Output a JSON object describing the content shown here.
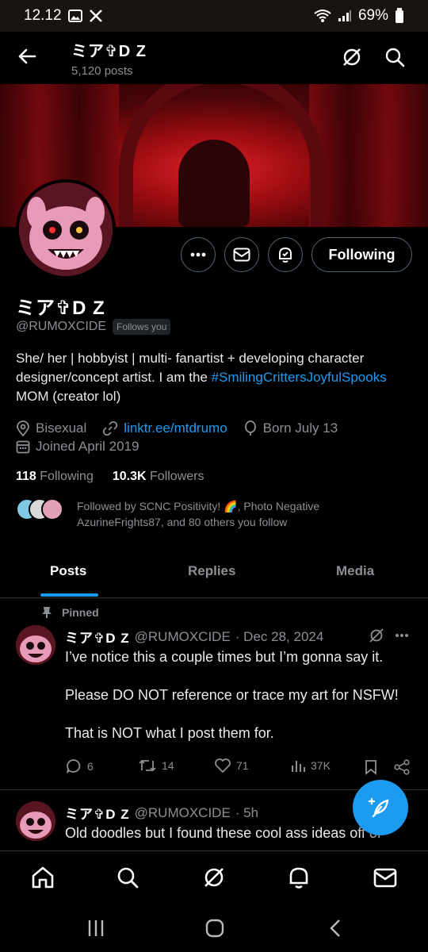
{
  "status_bar": {
    "time": "12.12",
    "battery": "69%"
  },
  "header": {
    "title": "ミア✞D Z",
    "post_count": "5,120 posts"
  },
  "profile": {
    "name": "ミア✞D Z",
    "handle": "@RUMOXCIDE",
    "follows_you": "Follows you",
    "follow_button": "Following",
    "bio_part1": "She/ her | hobbyist | multi- fanartist + developing character designer/concept artist. I am the ",
    "bio_hashtag": "#SmilingCrittersJoyfulSpooks",
    "bio_part2": " MOM (creator lol)",
    "location": "Bisexual",
    "link": "linktr.ee/mtdrumo",
    "born": "Born July 13",
    "joined": "Joined April 2019",
    "following_count": "118",
    "following_label": "Following",
    "followers_count": "10.3K",
    "followers_label": "Followers",
    "followed_by": "Followed by SCNC Positivity! 🌈, Photo Negative AzurineFrights87, and 80 others you follow"
  },
  "tabs": [
    {
      "label": "Posts"
    },
    {
      "label": "Replies"
    },
    {
      "label": "Media"
    }
  ],
  "posts": [
    {
      "pinned_label": "Pinned",
      "name": "ミア✞D Z",
      "handle": "@RUMOXCIDE",
      "date": "· Dec 28, 2024",
      "text": "I’ve notice this a couple times but I’m gonna say it.\n\nPlease DO NOT reference or trace my art for NSFW!\n\nThat is NOT what I post them for.",
      "replies": "6",
      "reposts": "14",
      "likes": "71",
      "views": "37K"
    },
    {
      "name": "ミア✞D Z",
      "handle": "@RUMOXCIDE",
      "date": "· 5h",
      "text": "Old doodles but I found these cool ass ideas off of"
    }
  ],
  "colors": {
    "accent": "#1d9bf0",
    "muted": "#8b8f94",
    "border": "#2f3336"
  }
}
